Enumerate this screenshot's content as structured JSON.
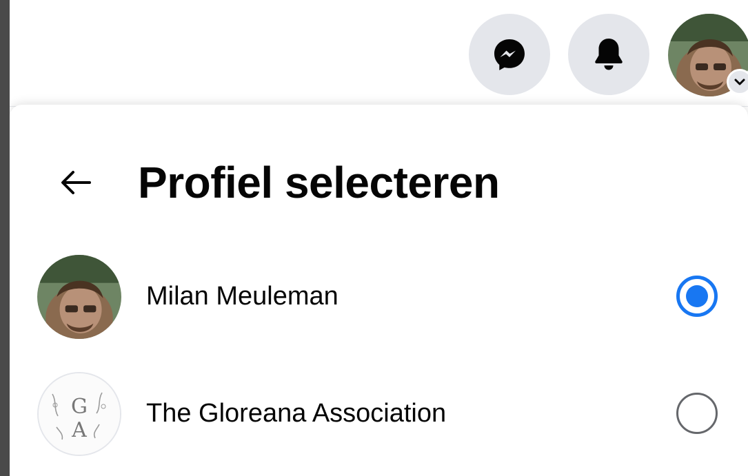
{
  "topbar": {
    "icons": [
      "messenger-icon",
      "bell-icon",
      "chevron-down-icon"
    ]
  },
  "panel": {
    "title": "Profiel selecteren",
    "back_icon": "arrow-left-icon"
  },
  "profiles": [
    {
      "name": "Milan Meuleman",
      "selected": true
    },
    {
      "name": "The Gloreana Association",
      "selected": false,
      "logo_text": "GA"
    }
  ],
  "colors": {
    "accent": "#1877f2",
    "button_bg": "#e4e6eb",
    "text": "#050505",
    "secondary": "#65676b"
  }
}
